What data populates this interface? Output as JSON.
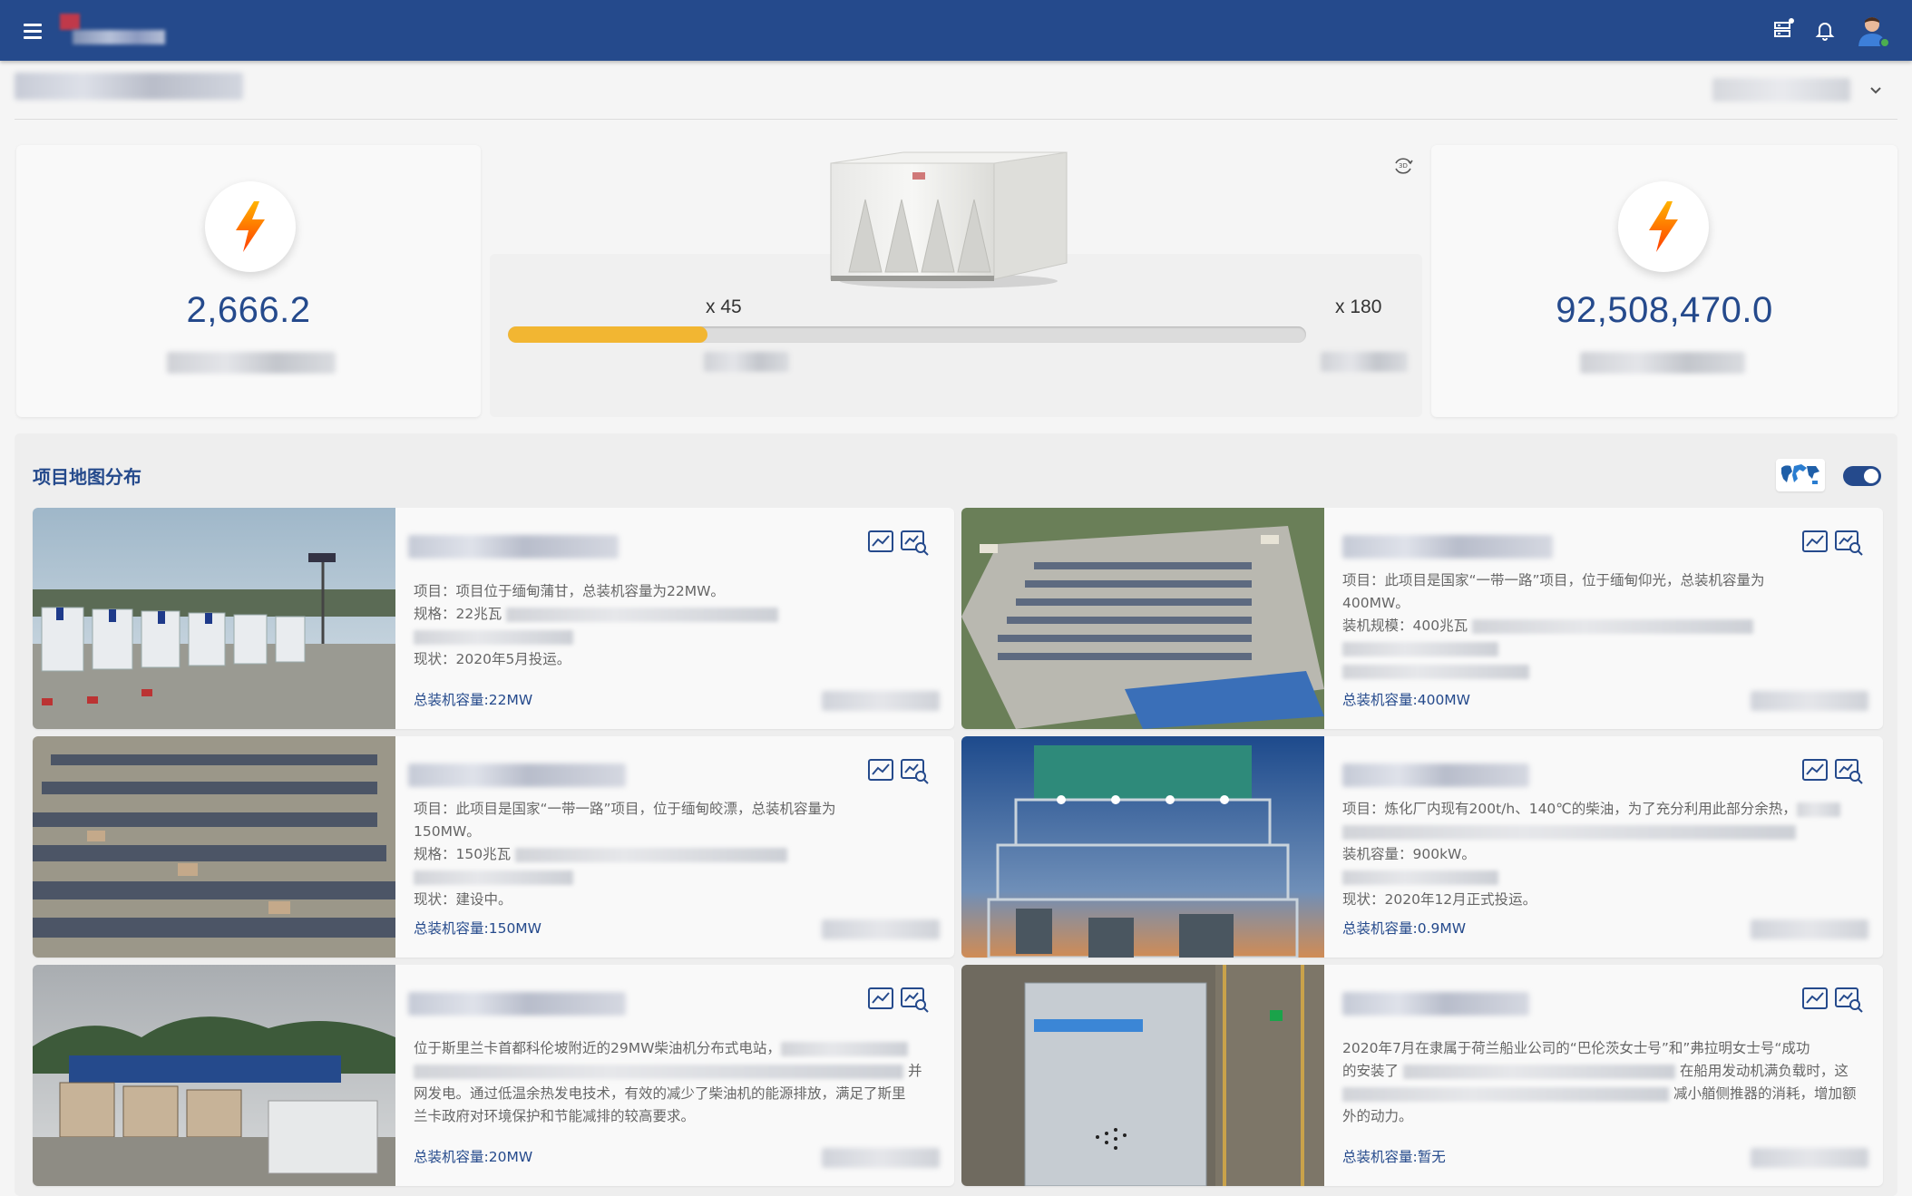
{
  "header": {
    "menu_icon": "hamburger-menu-icon",
    "icons": [
      "server-icon",
      "bell-icon",
      "user-avatar"
    ],
    "accent_color": "#254a8c"
  },
  "stats": {
    "left_value": "2,666.2",
    "right_value": "92,508,470.0",
    "icon": "lightning-bolt-icon",
    "multiplier_left": "x 45",
    "multiplier_right": "x 180",
    "progress_fraction": 0.25,
    "progress_color": "#f2b632"
  },
  "map_section": {
    "title": "项目地图分布",
    "map_icon": "world-map-icon",
    "toggle_on": true
  },
  "projects": [
    {
      "lines": [
        "项目：项目位于缅甸蒲甘，总装机容量为22MW。",
        "规格：22兆瓦",
        "",
        "现状：2020年5月投运。"
      ],
      "capacity": "总装机容量:22MW"
    },
    {
      "lines": [
        "项目：此项目是国家“一带一路”项目，位于缅甸仰光，总装机容量为",
        "400MW。",
        "装机规模：400兆瓦",
        "",
        ""
      ],
      "capacity": "总装机容量:400MW"
    },
    {
      "lines": [
        "项目：此项目是国家“一带一路”项目，位于缅甸皎漂，总装机容量为",
        "150MW。",
        "规格：150兆瓦",
        "",
        "现状：建设中。"
      ],
      "capacity": "总装机容量:150MW"
    },
    {
      "lines": [
        "项目：炼化厂内现有200t/h、140℃的柴油，为了充分利用此部分余热，",
        "",
        "装机容量：900kW。",
        "",
        "现状：2020年12月正式投运。"
      ],
      "capacity": "总装机容量:0.9MW"
    },
    {
      "lines": [
        "位于斯里兰卡首都科伦坡附近的29MW柴油机分布式电站，",
        "并",
        "网发电。通过低温余热发电技术，有效的减少了柴油机的能源排放，满足了斯里",
        "兰卡政府对环境保护和节能减排的较高要求。"
      ],
      "capacity": "总装机容量:20MW"
    },
    {
      "lines": [
        "2020年7月在隶属于荷兰船业公司的“巴伦茨女士号”和”弗拉明女士号“成功",
        "的安装了",
        "在船用发动机满负载时，这",
        "减小艏侧推器的消耗，增加额",
        "外的动力。"
      ],
      "capacity": "总装机容量:暂无"
    }
  ]
}
